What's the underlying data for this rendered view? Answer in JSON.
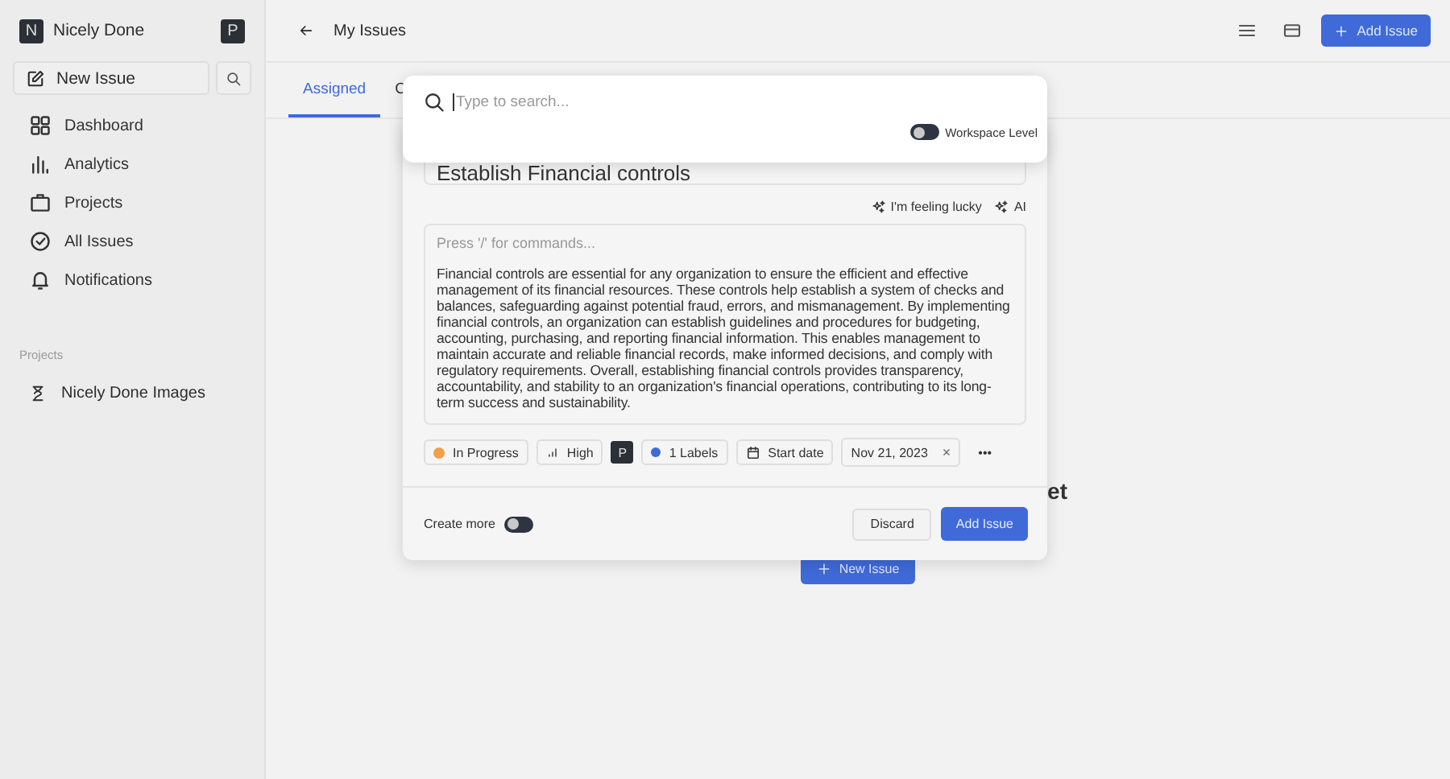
{
  "sidebar": {
    "workspace": {
      "initial": "N",
      "name": "Nicely Done"
    },
    "user_avatar": "P",
    "new_issue": "New Issue",
    "nav": [
      {
        "label": "Dashboard",
        "selected": false
      },
      {
        "label": "Analytics",
        "selected": false
      },
      {
        "label": "Projects",
        "selected": false
      },
      {
        "label": "All Issues",
        "selected": false
      },
      {
        "label": "Notifications",
        "selected": false
      }
    ],
    "projects_heading": "Projects",
    "projects": [
      {
        "label": "Nicely Done Images"
      }
    ]
  },
  "header": {
    "title": "My Issues",
    "add_button": "Add Issue"
  },
  "tabs": [
    {
      "label": "Assigned",
      "selected": true
    },
    {
      "label": "C",
      "selected": false
    }
  ],
  "empty_state": {
    "heading": "et",
    "button": "New Issue"
  },
  "issue_modal": {
    "title": "Establish Financial controls",
    "ai_actions": [
      "I'm feeling lucky",
      "AI"
    ],
    "editor_placeholder": "Press '/' for commands...",
    "description": "Financial controls are essential for any organization to ensure the efficient and effective management of its financial resources. These controls help establish a system of checks and balances, safeguarding against potential fraud, errors, and mismanagement. By implementing financial controls, an organization can establish guidelines and procedures for budgeting, accounting, purchasing, and reporting financial information. This enables management to maintain accurate and reliable financial records, make informed decisions, and comply with regulatory requirements. Overall, establishing financial controls provides transparency, accountability, and stability to an organization's financial operations, contributing to its long-term success and sustainability.",
    "chips": [
      {
        "kind": "state",
        "label": "In Progress",
        "color": "#f0a04b"
      },
      {
        "kind": "priority",
        "label": "High"
      },
      {
        "kind": "assignee",
        "label": "P"
      },
      {
        "kind": "labels",
        "label": "1 Labels",
        "color": "#3f6ad8"
      },
      {
        "kind": "start_date",
        "label": "Start date"
      },
      {
        "kind": "due_date",
        "label": "Nov 21, 2023",
        "clear": "×"
      },
      {
        "kind": "more",
        "label": "•••"
      }
    ],
    "create_more": {
      "label": "Create more",
      "on": false
    },
    "discard": "Discard",
    "submit": "Add Issue"
  },
  "search_palette": {
    "placeholder": "Type to search...",
    "workspace_level": {
      "label": "Workspace Level",
      "on": false
    }
  }
}
